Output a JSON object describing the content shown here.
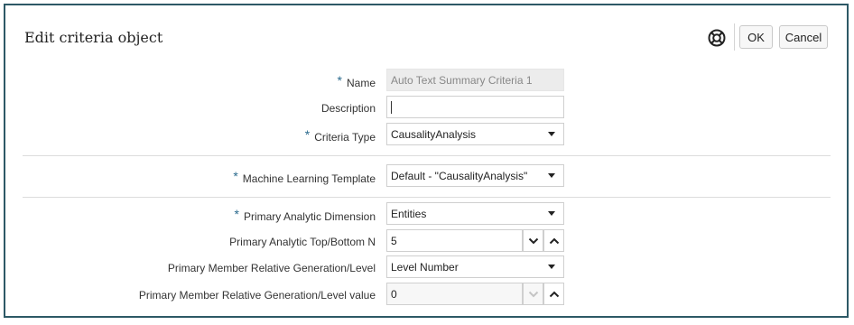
{
  "dialog": {
    "title": "Edit criteria object",
    "ok_label": "OK",
    "cancel_label": "Cancel"
  },
  "form": {
    "name_label": "Name",
    "name_value": "Auto Text Summary Criteria 1",
    "description_label": "Description",
    "description_value": "",
    "criteria_type_label": "Criteria Type",
    "criteria_type_value": "CausalityAnalysis",
    "ml_template_label": "Machine Learning Template",
    "ml_template_value": "Default - \"CausalityAnalysis\"",
    "primary_dimension_label": "Primary Analytic Dimension",
    "primary_dimension_value": "Entities",
    "top_bottom_label": "Primary Analytic Top/Bottom N",
    "top_bottom_value": "5",
    "relative_gen_label": "Primary Member Relative Generation/Level",
    "relative_gen_value": "Level Number",
    "relative_gen_value_label": "Primary Member Relative Generation/Level value",
    "relative_gen_value_value": "0"
  },
  "icons": {
    "help": "lifebuoy-icon",
    "required": "asterisk",
    "dropdown": "caret-down-icon",
    "decrement": "chevron-down-icon",
    "increment": "chevron-up-icon"
  },
  "colors": {
    "frame_border": "#2d5966",
    "required_star": "#2a6a8d"
  }
}
